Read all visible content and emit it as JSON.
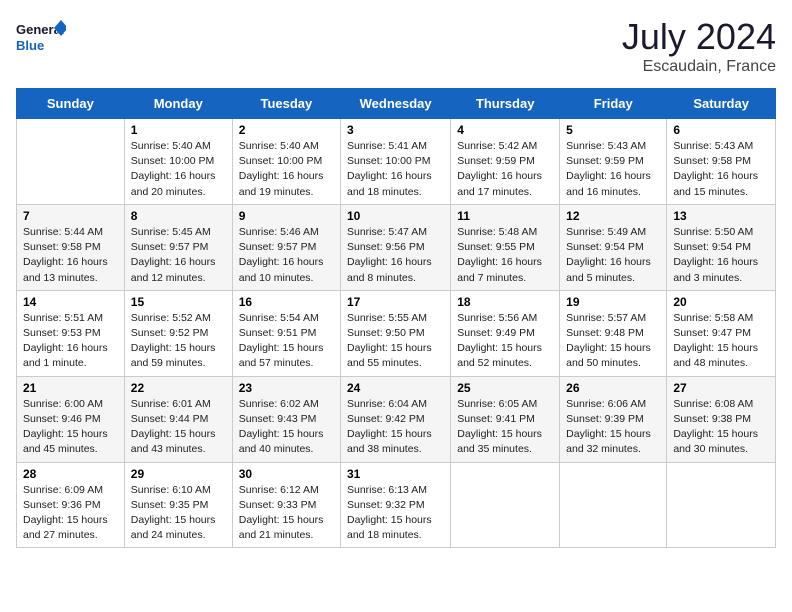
{
  "logo": {
    "line1": "General",
    "line2": "Blue"
  },
  "title": "July 2024",
  "subtitle": "Escaudain, France",
  "days_header": [
    "Sunday",
    "Monday",
    "Tuesday",
    "Wednesday",
    "Thursday",
    "Friday",
    "Saturday"
  ],
  "weeks": [
    [
      {
        "day": "",
        "info": ""
      },
      {
        "day": "1",
        "info": "Sunrise: 5:40 AM\nSunset: 10:00 PM\nDaylight: 16 hours\nand 20 minutes."
      },
      {
        "day": "2",
        "info": "Sunrise: 5:40 AM\nSunset: 10:00 PM\nDaylight: 16 hours\nand 19 minutes."
      },
      {
        "day": "3",
        "info": "Sunrise: 5:41 AM\nSunset: 10:00 PM\nDaylight: 16 hours\nand 18 minutes."
      },
      {
        "day": "4",
        "info": "Sunrise: 5:42 AM\nSunset: 9:59 PM\nDaylight: 16 hours\nand 17 minutes."
      },
      {
        "day": "5",
        "info": "Sunrise: 5:43 AM\nSunset: 9:59 PM\nDaylight: 16 hours\nand 16 minutes."
      },
      {
        "day": "6",
        "info": "Sunrise: 5:43 AM\nSunset: 9:58 PM\nDaylight: 16 hours\nand 15 minutes."
      }
    ],
    [
      {
        "day": "7",
        "info": "Sunrise: 5:44 AM\nSunset: 9:58 PM\nDaylight: 16 hours\nand 13 minutes."
      },
      {
        "day": "8",
        "info": "Sunrise: 5:45 AM\nSunset: 9:57 PM\nDaylight: 16 hours\nand 12 minutes."
      },
      {
        "day": "9",
        "info": "Sunrise: 5:46 AM\nSunset: 9:57 PM\nDaylight: 16 hours\nand 10 minutes."
      },
      {
        "day": "10",
        "info": "Sunrise: 5:47 AM\nSunset: 9:56 PM\nDaylight: 16 hours\nand 8 minutes."
      },
      {
        "day": "11",
        "info": "Sunrise: 5:48 AM\nSunset: 9:55 PM\nDaylight: 16 hours\nand 7 minutes."
      },
      {
        "day": "12",
        "info": "Sunrise: 5:49 AM\nSunset: 9:54 PM\nDaylight: 16 hours\nand 5 minutes."
      },
      {
        "day": "13",
        "info": "Sunrise: 5:50 AM\nSunset: 9:54 PM\nDaylight: 16 hours\nand 3 minutes."
      }
    ],
    [
      {
        "day": "14",
        "info": "Sunrise: 5:51 AM\nSunset: 9:53 PM\nDaylight: 16 hours\nand 1 minute."
      },
      {
        "day": "15",
        "info": "Sunrise: 5:52 AM\nSunset: 9:52 PM\nDaylight: 15 hours\nand 59 minutes."
      },
      {
        "day": "16",
        "info": "Sunrise: 5:54 AM\nSunset: 9:51 PM\nDaylight: 15 hours\nand 57 minutes."
      },
      {
        "day": "17",
        "info": "Sunrise: 5:55 AM\nSunset: 9:50 PM\nDaylight: 15 hours\nand 55 minutes."
      },
      {
        "day": "18",
        "info": "Sunrise: 5:56 AM\nSunset: 9:49 PM\nDaylight: 15 hours\nand 52 minutes."
      },
      {
        "day": "19",
        "info": "Sunrise: 5:57 AM\nSunset: 9:48 PM\nDaylight: 15 hours\nand 50 minutes."
      },
      {
        "day": "20",
        "info": "Sunrise: 5:58 AM\nSunset: 9:47 PM\nDaylight: 15 hours\nand 48 minutes."
      }
    ],
    [
      {
        "day": "21",
        "info": "Sunrise: 6:00 AM\nSunset: 9:46 PM\nDaylight: 15 hours\nand 45 minutes."
      },
      {
        "day": "22",
        "info": "Sunrise: 6:01 AM\nSunset: 9:44 PM\nDaylight: 15 hours\nand 43 minutes."
      },
      {
        "day": "23",
        "info": "Sunrise: 6:02 AM\nSunset: 9:43 PM\nDaylight: 15 hours\nand 40 minutes."
      },
      {
        "day": "24",
        "info": "Sunrise: 6:04 AM\nSunset: 9:42 PM\nDaylight: 15 hours\nand 38 minutes."
      },
      {
        "day": "25",
        "info": "Sunrise: 6:05 AM\nSunset: 9:41 PM\nDaylight: 15 hours\nand 35 minutes."
      },
      {
        "day": "26",
        "info": "Sunrise: 6:06 AM\nSunset: 9:39 PM\nDaylight: 15 hours\nand 32 minutes."
      },
      {
        "day": "27",
        "info": "Sunrise: 6:08 AM\nSunset: 9:38 PM\nDaylight: 15 hours\nand 30 minutes."
      }
    ],
    [
      {
        "day": "28",
        "info": "Sunrise: 6:09 AM\nSunset: 9:36 PM\nDaylight: 15 hours\nand 27 minutes."
      },
      {
        "day": "29",
        "info": "Sunrise: 6:10 AM\nSunset: 9:35 PM\nDaylight: 15 hours\nand 24 minutes."
      },
      {
        "day": "30",
        "info": "Sunrise: 6:12 AM\nSunset: 9:33 PM\nDaylight: 15 hours\nand 21 minutes."
      },
      {
        "day": "31",
        "info": "Sunrise: 6:13 AM\nSunset: 9:32 PM\nDaylight: 15 hours\nand 18 minutes."
      },
      {
        "day": "",
        "info": ""
      },
      {
        "day": "",
        "info": ""
      },
      {
        "day": "",
        "info": ""
      }
    ]
  ]
}
